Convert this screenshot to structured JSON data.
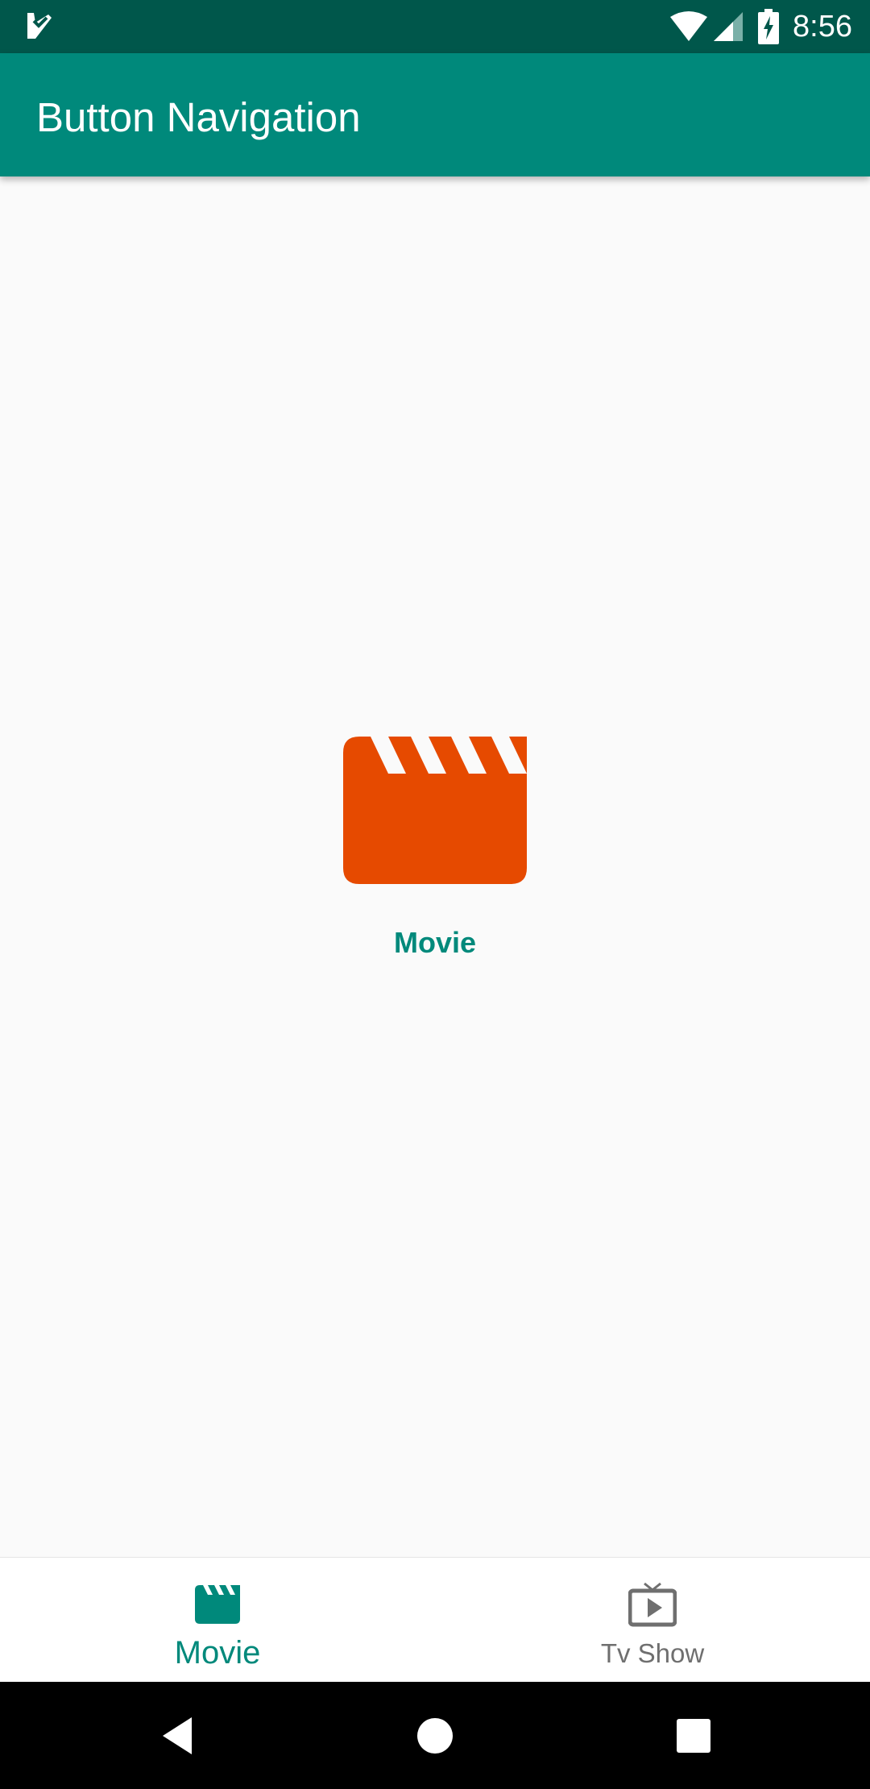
{
  "status_bar": {
    "time": "8:56",
    "icons": [
      "app-notification-icon",
      "wifi-icon",
      "cellular-signal-icon",
      "battery-charging-icon"
    ]
  },
  "app_bar": {
    "title": "Button Navigation"
  },
  "content": {
    "icon": "movie-clapperboard-icon",
    "label": "Movie"
  },
  "bottom_nav": {
    "items": [
      {
        "label": "Movie",
        "icon": "movie-icon",
        "active": true
      },
      {
        "label": "Tv Show",
        "icon": "tv-show-icon",
        "active": false
      }
    ]
  },
  "system_nav": {
    "buttons": [
      "back-icon",
      "home-icon",
      "recents-icon"
    ]
  },
  "colors": {
    "status_bar": "#00574b",
    "app_bar": "#00897b",
    "accent": "#00897b",
    "hero_icon": "#e64a00",
    "inactive": "#6f6f6f"
  }
}
